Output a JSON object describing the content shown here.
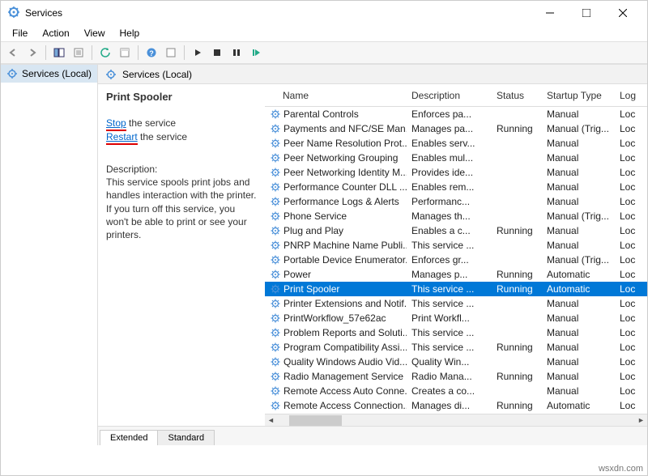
{
  "window": {
    "title": "Services"
  },
  "menubar": [
    "File",
    "Action",
    "View",
    "Help"
  ],
  "leftPane": {
    "item": "Services (Local)"
  },
  "rightHeader": "Services (Local)",
  "detail": {
    "title": "Print Spooler",
    "stopWord": "Stop",
    "stopRest": " the service",
    "restartWord": "Restart",
    "restartRest": " the service",
    "descLabel": "Description:",
    "descText": "This service spools print jobs and handles interaction with the printer. If you turn off this service, you won't be able to print or see your printers."
  },
  "columns": {
    "name": "Name",
    "desc": "Description",
    "status": "Status",
    "startup": "Startup Type",
    "logon": "Log"
  },
  "rows": [
    {
      "name": "Parental Controls",
      "desc": "Enforces pa...",
      "status": "",
      "startup": "Manual",
      "logon": "Loc"
    },
    {
      "name": "Payments and NFC/SE Man...",
      "desc": "Manages pa...",
      "status": "Running",
      "startup": "Manual (Trig...",
      "logon": "Loc"
    },
    {
      "name": "Peer Name Resolution Prot...",
      "desc": "Enables serv...",
      "status": "",
      "startup": "Manual",
      "logon": "Loc"
    },
    {
      "name": "Peer Networking Grouping",
      "desc": "Enables mul...",
      "status": "",
      "startup": "Manual",
      "logon": "Loc"
    },
    {
      "name": "Peer Networking Identity M...",
      "desc": "Provides ide...",
      "status": "",
      "startup": "Manual",
      "logon": "Loc"
    },
    {
      "name": "Performance Counter DLL ...",
      "desc": "Enables rem...",
      "status": "",
      "startup": "Manual",
      "logon": "Loc"
    },
    {
      "name": "Performance Logs & Alerts",
      "desc": "Performanc...",
      "status": "",
      "startup": "Manual",
      "logon": "Loc"
    },
    {
      "name": "Phone Service",
      "desc": "Manages th...",
      "status": "",
      "startup": "Manual (Trig...",
      "logon": "Loc"
    },
    {
      "name": "Plug and Play",
      "desc": "Enables a c...",
      "status": "Running",
      "startup": "Manual",
      "logon": "Loc"
    },
    {
      "name": "PNRP Machine Name Publi...",
      "desc": "This service ...",
      "status": "",
      "startup": "Manual",
      "logon": "Loc"
    },
    {
      "name": "Portable Device Enumerator...",
      "desc": "Enforces gr...",
      "status": "",
      "startup": "Manual (Trig...",
      "logon": "Loc"
    },
    {
      "name": "Power",
      "desc": "Manages p...",
      "status": "Running",
      "startup": "Automatic",
      "logon": "Loc"
    },
    {
      "name": "Print Spooler",
      "desc": "This service ...",
      "status": "Running",
      "startup": "Automatic",
      "logon": "Loc",
      "selected": true
    },
    {
      "name": "Printer Extensions and Notif...",
      "desc": "This service ...",
      "status": "",
      "startup": "Manual",
      "logon": "Loc"
    },
    {
      "name": "PrintWorkflow_57e62ac",
      "desc": "Print Workfl...",
      "status": "",
      "startup": "Manual",
      "logon": "Loc"
    },
    {
      "name": "Problem Reports and Soluti...",
      "desc": "This service ...",
      "status": "",
      "startup": "Manual",
      "logon": "Loc"
    },
    {
      "name": "Program Compatibility Assi...",
      "desc": "This service ...",
      "status": "Running",
      "startup": "Manual",
      "logon": "Loc"
    },
    {
      "name": "Quality Windows Audio Vid...",
      "desc": "Quality Win...",
      "status": "",
      "startup": "Manual",
      "logon": "Loc"
    },
    {
      "name": "Radio Management Service",
      "desc": "Radio Mana...",
      "status": "Running",
      "startup": "Manual",
      "logon": "Loc"
    },
    {
      "name": "Remote Access Auto Conne...",
      "desc": "Creates a co...",
      "status": "",
      "startup": "Manual",
      "logon": "Loc"
    },
    {
      "name": "Remote Access Connection...",
      "desc": "Manages di...",
      "status": "Running",
      "startup": "Automatic",
      "logon": "Loc"
    }
  ],
  "tabs": {
    "extended": "Extended",
    "standard": "Standard"
  },
  "watermark": "wsxdn.com"
}
